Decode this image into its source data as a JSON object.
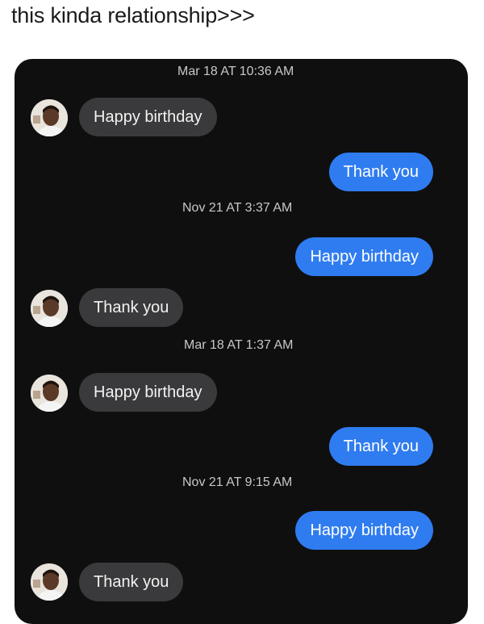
{
  "post": {
    "caption": "this kinda relationship>>>"
  },
  "thread": {
    "timestamps": [
      "Mar 18 AT 10:36 AM",
      "Nov 21 AT 3:37 AM",
      "Mar 18 AT 1:37 AM",
      "Nov 21 AT 9:15 AM"
    ],
    "messages": [
      {
        "side": "received",
        "text": "Happy birthday"
      },
      {
        "side": "sent",
        "text": "Thank you"
      },
      {
        "side": "sent",
        "text": "Happy birthday"
      },
      {
        "side": "received",
        "text": "Thank you"
      },
      {
        "side": "received",
        "text": "Happy birthday"
      },
      {
        "side": "sent",
        "text": "Thank you"
      },
      {
        "side": "sent",
        "text": "Happy birthday"
      },
      {
        "side": "received",
        "text": "Thank you"
      }
    ]
  },
  "colors": {
    "received_bubble": "#3a3a3c",
    "sent_bubble": "#2f7cf0",
    "background": "#0f0f0f"
  },
  "icons": {
    "contact_avatar": "person-photo-icon"
  }
}
